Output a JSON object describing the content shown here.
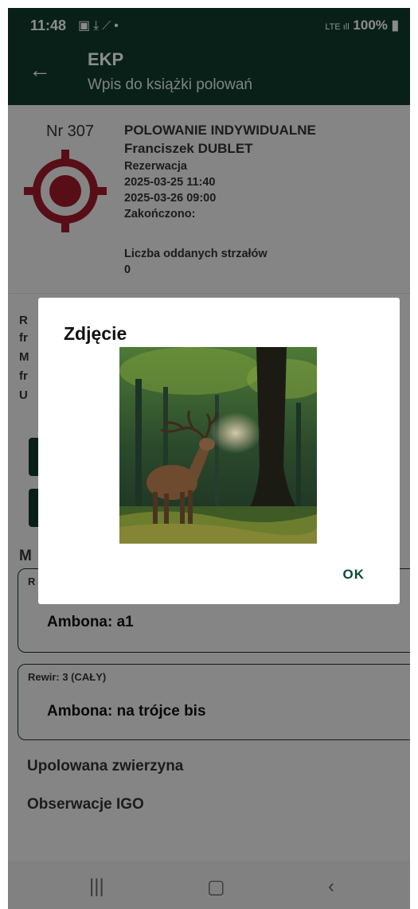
{
  "status": {
    "time": "11:48",
    "battery": "100%"
  },
  "appbar": {
    "title": "EKP",
    "subtitle": "Wpis do książki polowań"
  },
  "hunt": {
    "number": "Nr 307",
    "type": "POLOWANIE INDYWIDUALNE",
    "hunter": "Franciszek DUBLET",
    "status": "Rezerwacja",
    "start": "2025-03-25 11:40",
    "end": "2025-03-26 09:00",
    "finished_label": "Zakończono:",
    "shots_label": "Liczba oddanych strzałów",
    "shots_value": "0"
  },
  "peek": {
    "r": "R",
    "f1": "fr",
    "m": "M",
    "f2": "fr",
    "u": "U",
    "m2": "M"
  },
  "stands": [
    {
      "area": "R",
      "stand": "Ambona: a1"
    },
    {
      "area": "Rewir: 3 (CAŁY)",
      "stand": "Ambona: na trójce bis"
    }
  ],
  "sections": {
    "game": "Upolowana zwierzyna",
    "observations": "Obserwacje IGO"
  },
  "dialog": {
    "title": "Zdjęcie",
    "ok": "OK"
  },
  "nav": {
    "recent": "|||",
    "home": "▢",
    "back": "‹"
  }
}
